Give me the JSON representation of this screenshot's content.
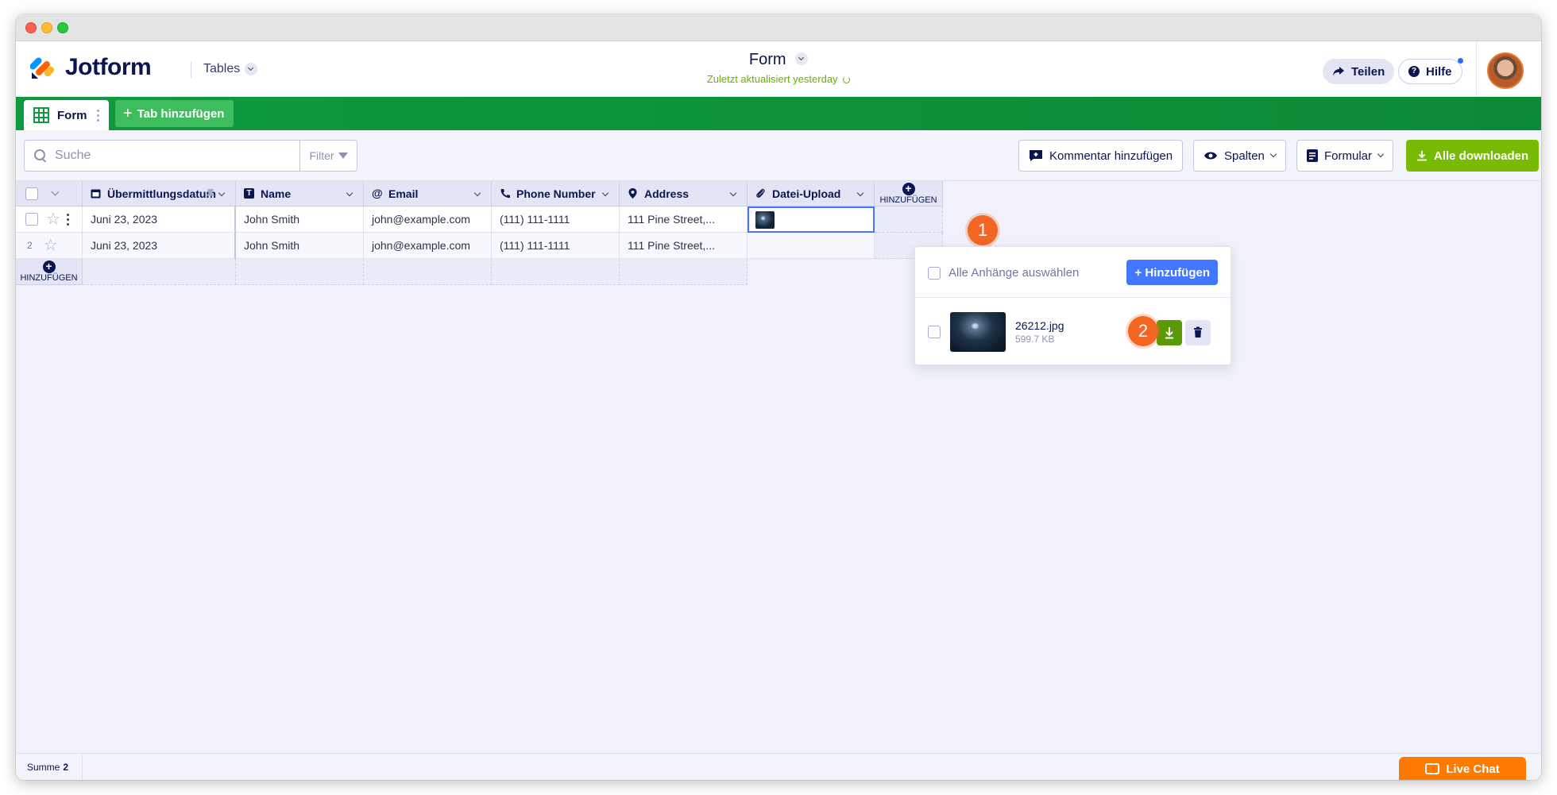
{
  "app": {
    "logo_text": "Jotform",
    "tables_label": "Tables"
  },
  "header": {
    "form_title": "Form",
    "updated_text": "Zuletzt aktualisiert yesterday",
    "share_label": "Teilen",
    "help_label": "Hilfe"
  },
  "tabs": {
    "form_tab_label": "Form",
    "add_tab_label": "Tab hinzufügen"
  },
  "toolbar": {
    "search_placeholder": "Suche",
    "filter_label": "Filter",
    "comment_label": "Kommentar hinzufügen",
    "columns_label": "Spalten",
    "form_label": "Formular",
    "download_all_label": "Alle downloaden"
  },
  "table": {
    "columns": [
      "Übermittlungsdatum",
      "Name",
      "Email",
      "Phone Number",
      "Address",
      "Datei-Upload"
    ],
    "add_column_label": "HINZUFÜGEN",
    "add_row_label": "HINZUFÜGEN",
    "rows": [
      {
        "num": "",
        "date": "Juni 23, 2023",
        "name": "John Smith",
        "email": "john@example.com",
        "phone": "(111) 111-1111",
        "address": "111 Pine Street,..."
      },
      {
        "num": "2",
        "date": "Juni 23, 2023",
        "name": "John Smith",
        "email": "john@example.com",
        "phone": "(111) 111-1111",
        "address": "111 Pine Street,..."
      }
    ]
  },
  "annotations": {
    "badge_1": "1",
    "badge_2": "2"
  },
  "popover": {
    "select_all_label": "Alle Anhänge auswählen",
    "add_label": "+ Hinzufügen",
    "file_name": "26212.jpg",
    "file_size": "599.7 KB"
  },
  "footer": {
    "sum_label": "Summe",
    "sum_value": "2",
    "live_chat_label": "Live Chat"
  },
  "colors": {
    "brand_green": "#0f9a3e",
    "download_green": "#78bb07",
    "primary_blue": "#4277ff",
    "badge_orange": "#f26522",
    "live_chat_orange": "#ff7a00"
  }
}
